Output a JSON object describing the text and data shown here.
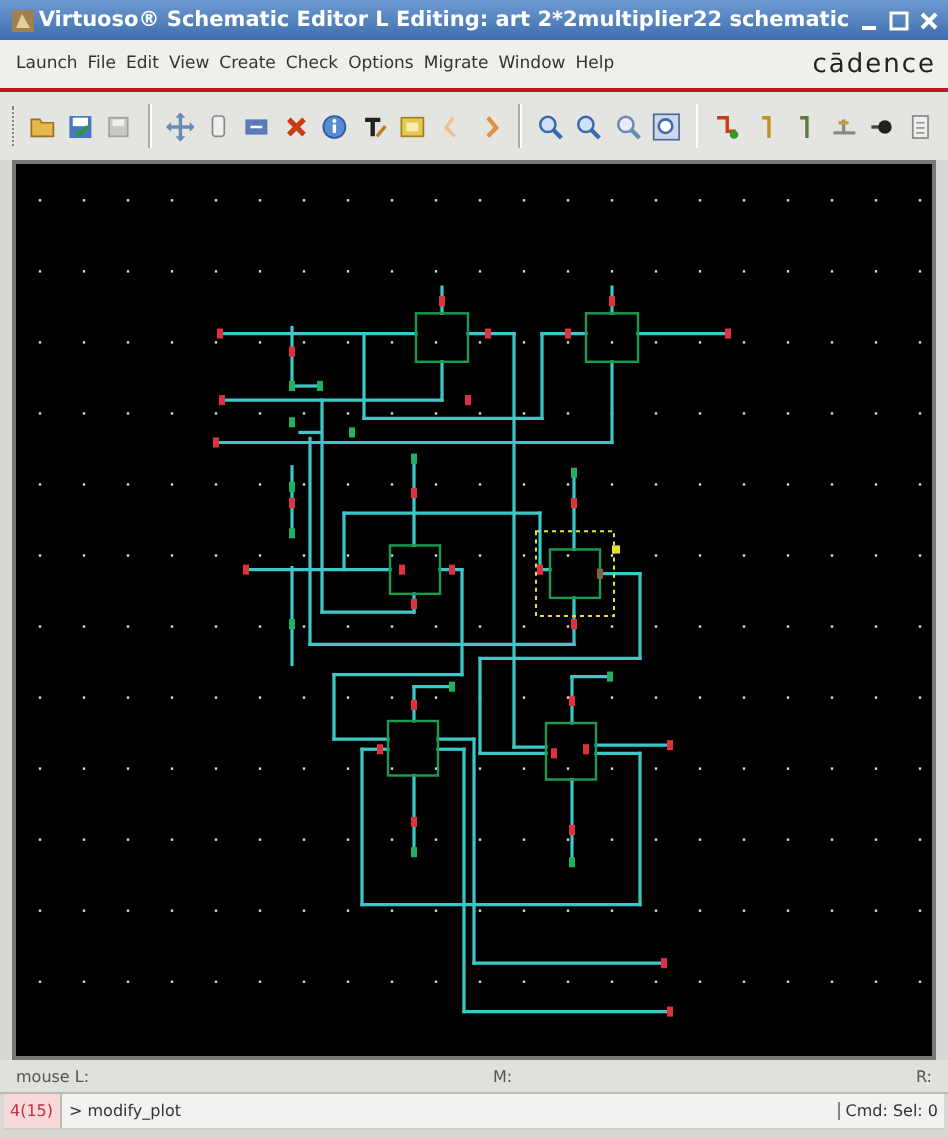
{
  "window": {
    "title": "Virtuoso® Schematic Editor L Editing: art 2*2multiplier22 schematic"
  },
  "menu": {
    "items": [
      "Launch",
      "File",
      "Edit",
      "View",
      "Create",
      "Check",
      "Options",
      "Migrate",
      "Window",
      "Help"
    ],
    "logo": "cādence"
  },
  "status_bar": {
    "mouse_left": "mouse L:",
    "mouse_middle": "M:",
    "mouse_right": "R:"
  },
  "command_line": {
    "prompt": "4(15)",
    "command": "> modify_plot",
    "selection": "Cmd: Sel: 0"
  }
}
